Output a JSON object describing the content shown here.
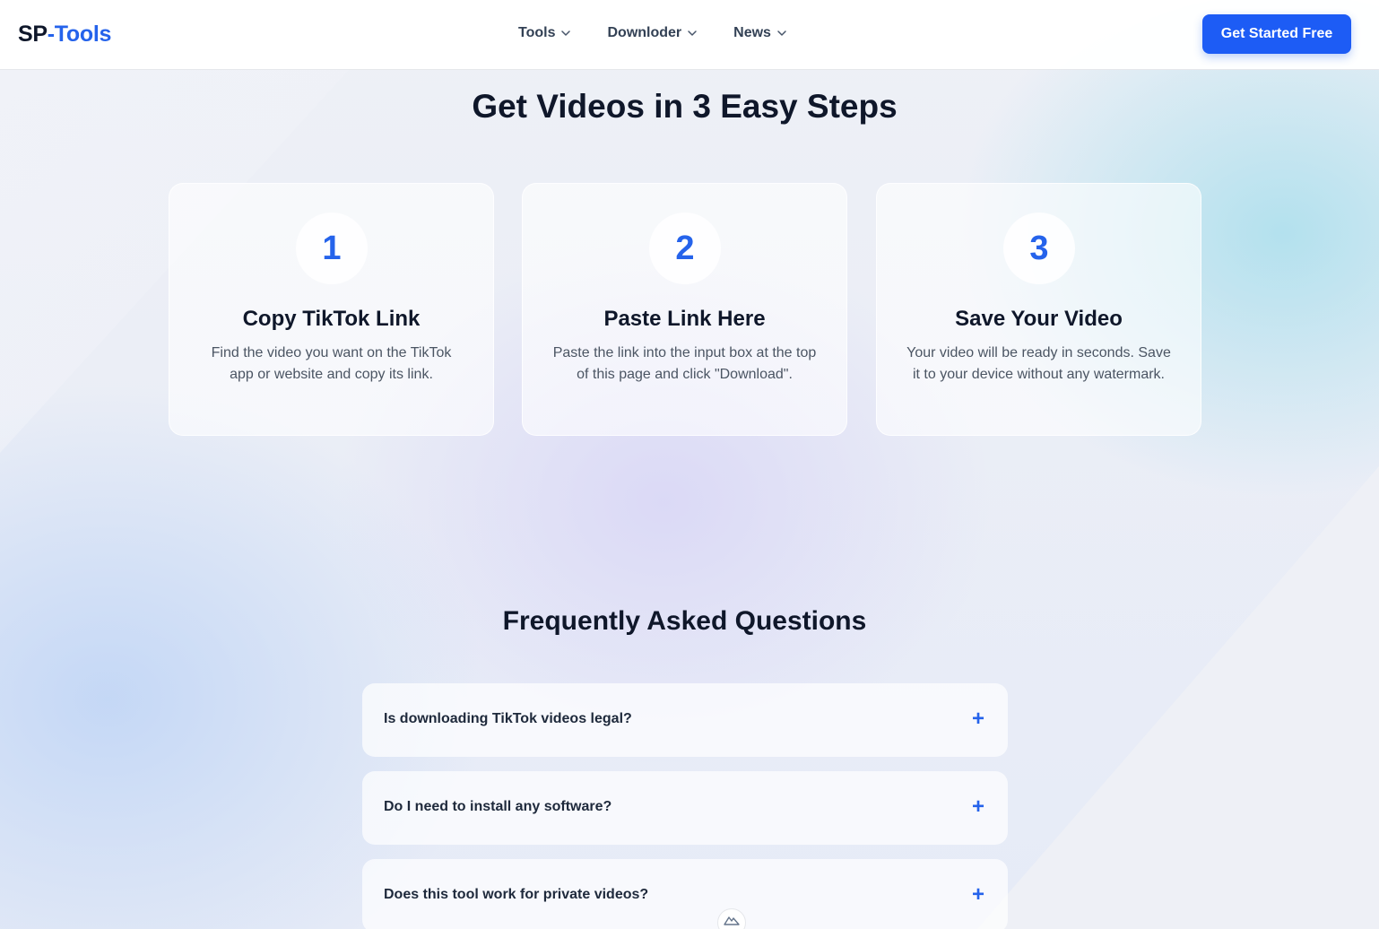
{
  "brand": {
    "part1": "SP",
    "part2": "-Tools"
  },
  "nav": {
    "items": [
      {
        "label": "Tools"
      },
      {
        "label": "Downloder"
      },
      {
        "label": "News"
      }
    ]
  },
  "header": {
    "cta_label": "Get Started Free"
  },
  "steps": {
    "title": "Get Videos in 3 Easy Steps",
    "items": [
      {
        "number": "1",
        "title": "Copy TikTok Link",
        "description": "Find the video you want on the TikTok app or website and copy its link."
      },
      {
        "number": "2",
        "title": "Paste Link Here",
        "description": "Paste the link into the input box at the top of this page and click \"Download\"."
      },
      {
        "number": "3",
        "title": "Save Your Video",
        "description": "Your video will be ready in seconds. Save it to your device without any watermark."
      }
    ]
  },
  "faq": {
    "title": "Frequently Asked Questions",
    "items": [
      {
        "question": "Is downloading TikTok videos legal?",
        "icon": "+"
      },
      {
        "question": "Do I need to install any software?",
        "icon": "+"
      },
      {
        "question": "Does this tool work for private videos?",
        "icon": "+"
      }
    ]
  },
  "colors": {
    "accent": "#1d5cf5",
    "text": "#0f172a",
    "muted": "#4b5563"
  }
}
